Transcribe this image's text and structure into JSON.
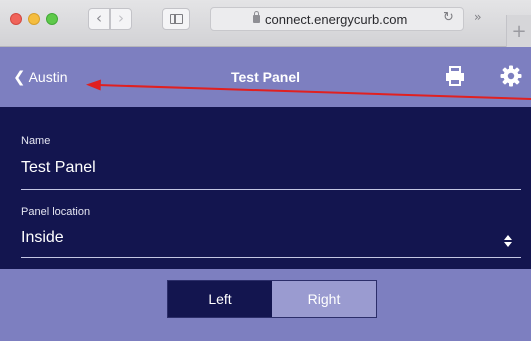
{
  "browser": {
    "url": "connect.energycurb.com",
    "icons": [
      "back-chevron-icon",
      "forward-chevron-icon",
      "sidebar-icon",
      "lock-icon",
      "reload-icon",
      "more-icon",
      "new-tab-icon"
    ]
  },
  "header": {
    "back_label": "Austin",
    "title": "Test Panel",
    "accent_color": "#7d7fc0",
    "icons": [
      "print-icon",
      "gear-icon"
    ]
  },
  "form": {
    "background": "#13154f",
    "name": {
      "label": "Name",
      "value": "Test Panel"
    },
    "location": {
      "label": "Panel location",
      "value": "Inside"
    }
  },
  "side_toggle": {
    "options": [
      "Left",
      "Right"
    ],
    "selected": "Left"
  },
  "annotation": {
    "type": "arrow",
    "color": "#e02020"
  }
}
